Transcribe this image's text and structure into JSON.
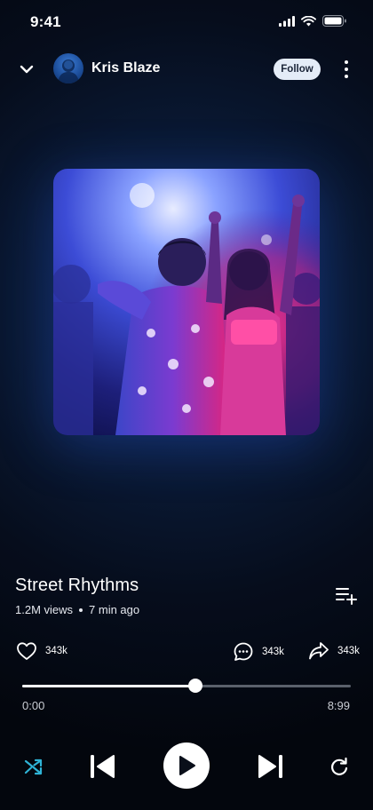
{
  "status_bar": {
    "time": "9:41"
  },
  "header": {
    "artist_name": "Kris Blaze",
    "follow_label": "Follow"
  },
  "song": {
    "title": "Street Rhythms",
    "views": "1.2M views",
    "posted": "7 min ago"
  },
  "actions": {
    "likes": "343k",
    "comments": "343k",
    "shares": "343k"
  },
  "player": {
    "current_time": "0:00",
    "total_time": "8:99",
    "progress": 0.527
  },
  "colors": {
    "accent": "#2fb3d6",
    "follow_bg": "#e4ecf7"
  },
  "icons": [
    "chevron-down-icon",
    "more-vertical-icon",
    "queue-add-icon",
    "heart-icon",
    "comment-icon",
    "share-icon",
    "shuffle-icon",
    "previous-icon",
    "play-icon",
    "next-icon",
    "repeat-icon"
  ]
}
